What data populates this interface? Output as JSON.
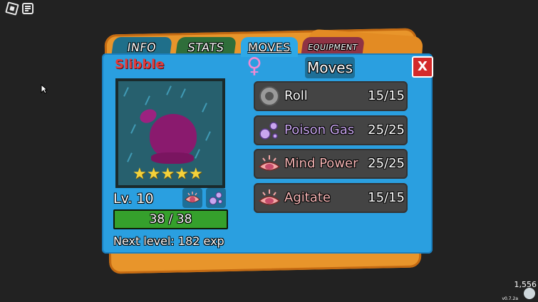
{
  "tabs": [
    {
      "label": "INFO",
      "active": false
    },
    {
      "label": "STATS",
      "active": false
    },
    {
      "label": "MOVES",
      "active": true
    },
    {
      "label": "EQUIPMENT",
      "active": false
    }
  ],
  "pet": {
    "name": "Slibble",
    "gender_symbol": "♀",
    "stars": "★★★★★",
    "star_count": 5,
    "level_label": "Lv. 10",
    "hp_text": "38 / 38",
    "hp_current": 38,
    "hp_max": 38,
    "next_level_text": "Next level: 182 exp",
    "types": [
      "mind-type-icon",
      "poison-type-icon"
    ]
  },
  "moves_panel": {
    "title": "Moves",
    "close_label": "X",
    "moves": [
      {
        "name": "Roll",
        "pp": "15/15",
        "icon": "roll-icon",
        "name_color": "#ffffff"
      },
      {
        "name": "Poison Gas",
        "pp": "25/25",
        "icon": "poison-bubbles-icon",
        "name_color": "#c9a6ef"
      },
      {
        "name": "Mind Power",
        "pp": "25/25",
        "icon": "mind-eye-icon",
        "name_color": "#f7b6b6"
      },
      {
        "name": "Agitate",
        "pp": "15/15",
        "icon": "mind-eye-icon",
        "name_color": "#f7b6b6"
      }
    ]
  },
  "hud": {
    "currency": "1,556",
    "version": "v0.7.2a"
  },
  "colors": {
    "panel_blue": "#2a9fe0",
    "back_orange": "#e8952b",
    "name_red": "#e33b3b",
    "hp_green": "#35a02c"
  }
}
